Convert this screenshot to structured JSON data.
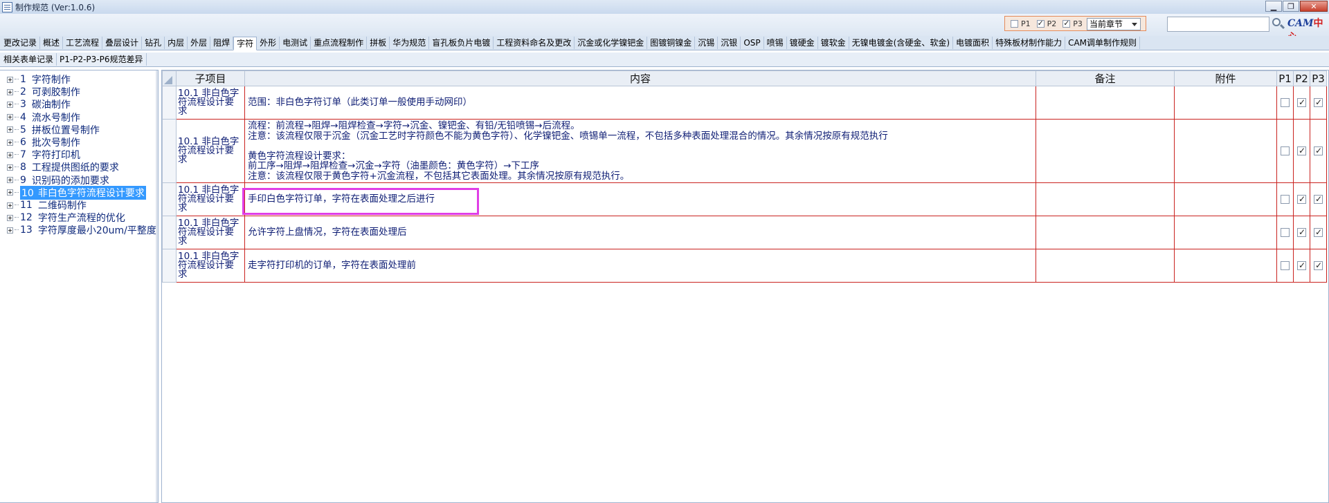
{
  "window": {
    "title": "制作规范 (Ver:1.0.6)",
    "controls": [
      "▁",
      "❐",
      "✕"
    ]
  },
  "toolbar": {
    "filters": [
      {
        "label": "P1",
        "checked": false
      },
      {
        "label": "P2",
        "checked": true
      },
      {
        "label": "P3",
        "checked": true
      }
    ],
    "scope_select": "当前章节",
    "search_value": "",
    "logo_main": "CAM",
    "logo_accent": "中心"
  },
  "tabs_row1": [
    "更改记录",
    "概述",
    "工艺流程",
    "叠层设计",
    "钻孔",
    "内层",
    "外层",
    "阻焊",
    "字符",
    "外形",
    "电测试",
    "重点流程制作",
    "拼板",
    "华为规范",
    "盲孔板负片电镀",
    "工程资料命名及更改",
    "沉金或化学镍钯金",
    "图镀铜镍金",
    "沉锡",
    "沉银",
    "OSP",
    "喷锡",
    "镀硬金",
    "镀软金",
    "无镍电镀金(含硬金、软金)",
    "电镀面积",
    "特殊板材制作能力",
    "CAM调单制作规则"
  ],
  "active_tab": "字符",
  "tabs_row2": [
    "相关表单记录",
    "P1-P2-P3-P6规范差异"
  ],
  "tree": [
    {
      "num": "1",
      "label": "字符制作"
    },
    {
      "num": "2",
      "label": "可剥胶制作"
    },
    {
      "num": "3",
      "label": "碳油制作"
    },
    {
      "num": "4",
      "label": "流水号制作"
    },
    {
      "num": "5",
      "label": "拼板位置号制作"
    },
    {
      "num": "6",
      "label": "批次号制作"
    },
    {
      "num": "7",
      "label": "字符打印机"
    },
    {
      "num": "8",
      "label": "工程提供图纸的要求"
    },
    {
      "num": "9",
      "label": "识别码的添加要求"
    },
    {
      "num": "10",
      "label": "非白色字符流程设计要求",
      "selected": true
    },
    {
      "num": "11",
      "label": "二维码制作"
    },
    {
      "num": "12",
      "label": "字符生产流程的优化"
    },
    {
      "num": "13",
      "label": "字符厚度最小20um/平整度"
    }
  ],
  "grid": {
    "columns": [
      "子项目",
      "内容",
      "备注",
      "附件",
      "P1",
      "P2",
      "P3"
    ],
    "rows": [
      {
        "sub": "10.1 非白色字符流程设计要求",
        "content": "范围：非白色字符订单（此类订单一般使用手动网印）",
        "note": "",
        "attach": "",
        "p1": false,
        "p2": true,
        "p3": true
      },
      {
        "sub": "10.1 非白色字符流程设计要求",
        "content": "流程：前流程→阻焊→阻焊检查→字符→沉金、镍钯金、有铅/无铅喷锡→后流程。\n注意：该流程仅限于沉金（沉金工艺时字符颜色不能为黄色字符）、化学镍钯金、喷锡单一流程，不包括多种表面处理混合的情况。其余情况按原有规范执行\n\n黄色字符流程设计要求：\n前工序→阻焊→阻焊检查→沉金→字符（油墨颜色：黄色字符）→下工序\n注意：该流程仅限于黄色字符+沉金流程，不包括其它表面处理。其余情况按原有规范执行。",
        "note": "",
        "attach": "",
        "p1": false,
        "p2": true,
        "p3": true
      },
      {
        "sub": "10.1 非白色字符流程设计要求",
        "content": "手印白色字符订单，字符在表面处理之后进行",
        "note": "",
        "attach": "",
        "p1": false,
        "p2": true,
        "p3": true
      },
      {
        "sub": "10.1 非白色字符流程设计要求",
        "content": "允许字符上盘情况，字符在表面处理后",
        "note": "",
        "attach": "",
        "p1": false,
        "p2": true,
        "p3": true
      },
      {
        "sub": "10.1 非白色字符流程设计要求",
        "content": "走字符打印机的订单，字符在表面处理前",
        "note": "",
        "attach": "",
        "p1": false,
        "p2": true,
        "p3": true
      }
    ]
  },
  "colors": {
    "highlight": "#e03ee6",
    "row_border": "#c9211e",
    "text": "#0e1d74",
    "selection": "#3399ff"
  }
}
